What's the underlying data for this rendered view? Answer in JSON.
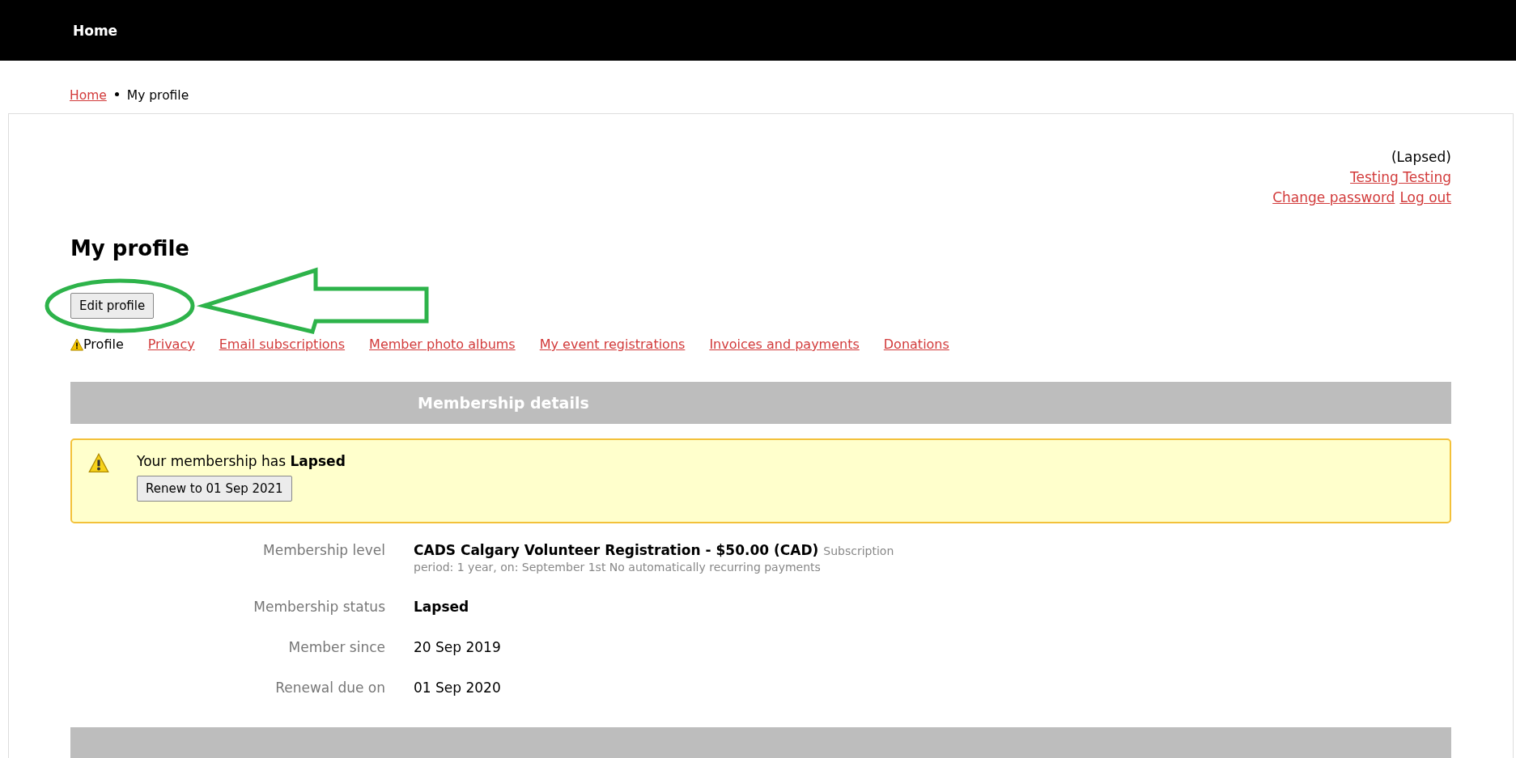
{
  "top_nav": {
    "items": [
      {
        "label": "Home",
        "selected": true
      }
    ]
  },
  "breadcrumb": {
    "link": "Home",
    "current": "My profile"
  },
  "account": {
    "status": "(Lapsed)",
    "name": "Testing Testing",
    "links": [
      "Change password",
      "Log out"
    ]
  },
  "page_title": "My profile",
  "edit_button": "Edit profile",
  "tabs": [
    {
      "label": "Profile",
      "selected": true,
      "warning": true
    },
    {
      "label": "Privacy",
      "selected": false,
      "warning": false
    },
    {
      "label": "Email subscriptions",
      "selected": false,
      "warning": false
    },
    {
      "label": "Member photo albums",
      "selected": false,
      "warning": false
    },
    {
      "label": "My event registrations",
      "selected": false,
      "warning": false
    },
    {
      "label": "Invoices and payments",
      "selected": false,
      "warning": false
    },
    {
      "label": "Donations",
      "selected": false,
      "warning": false
    }
  ],
  "section_title": "Membership details",
  "alert": {
    "message": "Your membership has **Lapsed**",
    "button": "Renew to 01 Sep 2021"
  },
  "details": [
    {
      "label": "Membership level",
      "value": "CADS Calgary Volunteer Registration - $50.00 (CAD)",
      "note": "Subscription",
      "subnote": "period: 1 year, on: September 1st No automatically recurring payments",
      "bold": true
    },
    {
      "label": "Membership status",
      "value": "Lapsed",
      "bold": true
    },
    {
      "label": "Member since",
      "value": "20 Sep 2019",
      "bold": false
    },
    {
      "label": "Renewal due on",
      "value": "01 Sep 2020",
      "bold": false
    }
  ]
}
